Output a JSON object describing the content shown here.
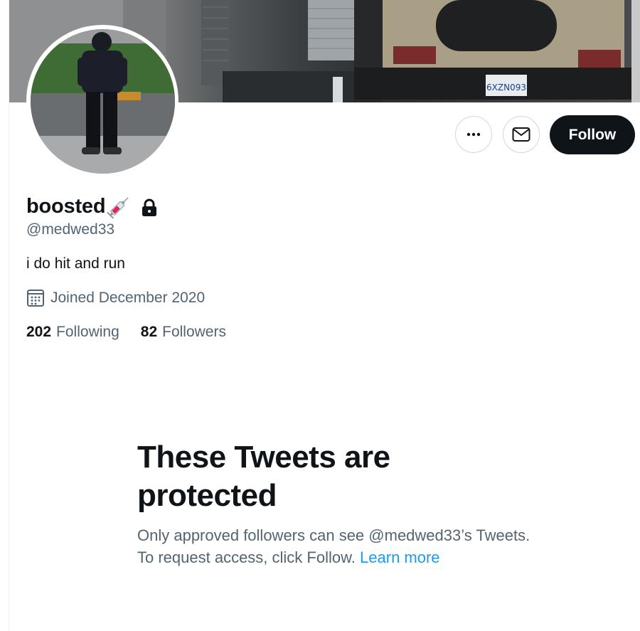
{
  "profile": {
    "display_name": "boosted",
    "handle": "@medwed33",
    "bio": "i do hit and run",
    "joined": "Joined December 2020",
    "following_count": "202",
    "following_label": "Following",
    "followers_count": "82",
    "followers_label": "Followers",
    "badges": [
      "syringe-emoji",
      "lock-icon"
    ]
  },
  "banner": {
    "license_plate": "6XZN093"
  },
  "actions": {
    "more_icon": "more-horizontal-icon",
    "message_icon": "envelope-icon",
    "follow_label": "Follow"
  },
  "protected": {
    "title": "These Tweets are protected",
    "body": "Only approved followers can see @medwed33’s Tweets. To request access, click Follow.",
    "learn_more": "Learn more"
  },
  "colors": {
    "text_primary": "#0f1419",
    "text_secondary": "#536471",
    "link": "#1d9bf0",
    "follow_bg": "#0f1419",
    "border": "#cfd9de"
  }
}
